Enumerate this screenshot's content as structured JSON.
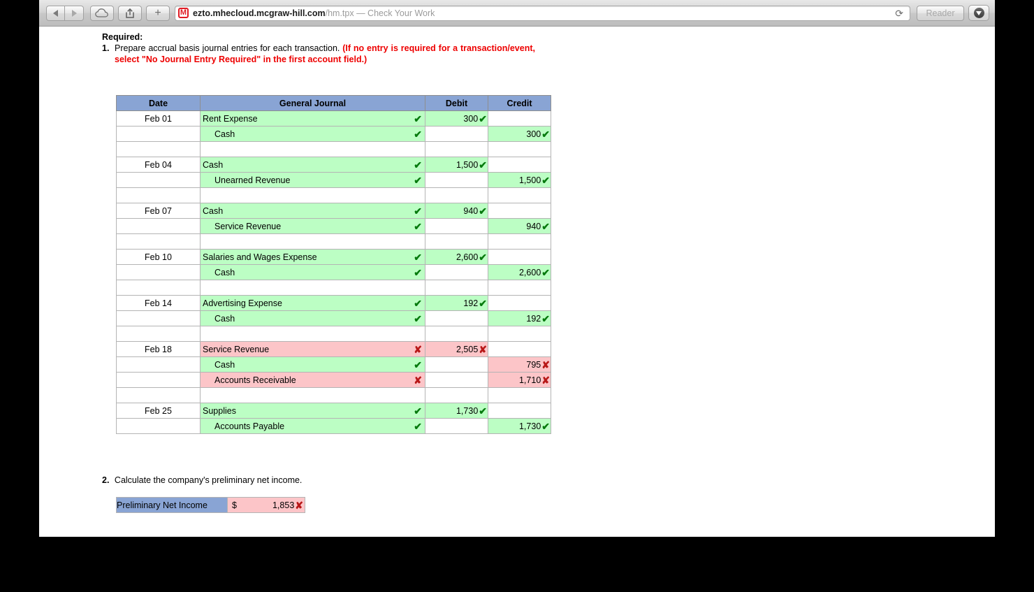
{
  "browser": {
    "back_icon": "triangle-left-icon",
    "forward_icon": "triangle-right-icon",
    "icloud_icon": "cloud-icon",
    "share_icon": "share-icon",
    "newtab_label": "+",
    "favicon_letter": "M",
    "url_host": "ezto.mhecloud.mcgraw-hill.com",
    "url_path": "/hm.tpx — Check Your Work",
    "reload_icon": "⟳",
    "reader_label": "Reader",
    "download_icon": "download-icon"
  },
  "page": {
    "required_label": "Required:",
    "instruction": {
      "number": "1.",
      "black_text": "Prepare accrual basis journal entries for each transaction.",
      "red_text": "(If no entry is required for a transaction/event, select \"No Journal Entry Required\" in the first account field.)"
    },
    "part2": {
      "number": "2.",
      "text": "Calculate the company's preliminary net income."
    },
    "net_income": {
      "label": "Preliminary Net Income",
      "currency": "$",
      "amount": "1,853",
      "mark": "✘",
      "mark_status": "incorrect"
    }
  },
  "journal": {
    "columns": [
      "Date",
      "General Journal",
      "Debit",
      "Credit"
    ],
    "marks": {
      "correct": "✔",
      "incorrect": "✘"
    },
    "colors": {
      "header_blue": "#89a4d4",
      "correct_green": "#bcfec4",
      "incorrect_pink": "#fcc5c8",
      "check_green": "#057a0d",
      "cross_red": "#b81818"
    },
    "rows": [
      {
        "type": "entry",
        "date": "Feb 01",
        "account": "Rent Expense",
        "indent": false,
        "acct_status": "correct",
        "debit": "300",
        "debit_status": "correct",
        "credit": "",
        "credit_status": ""
      },
      {
        "type": "entry",
        "date": "",
        "account": "Cash",
        "indent": true,
        "acct_status": "correct",
        "debit": "",
        "debit_status": "",
        "credit": "300",
        "credit_status": "correct"
      },
      {
        "type": "spacer"
      },
      {
        "type": "entry",
        "date": "Feb 04",
        "account": "Cash",
        "indent": false,
        "acct_status": "correct",
        "debit": "1,500",
        "debit_status": "correct",
        "credit": "",
        "credit_status": ""
      },
      {
        "type": "entry",
        "date": "",
        "account": "Unearned Revenue",
        "indent": true,
        "acct_status": "correct",
        "debit": "",
        "debit_status": "",
        "credit": "1,500",
        "credit_status": "correct"
      },
      {
        "type": "spacer"
      },
      {
        "type": "entry",
        "date": "Feb 07",
        "account": "Cash",
        "indent": false,
        "acct_status": "correct",
        "debit": "940",
        "debit_status": "correct",
        "credit": "",
        "credit_status": ""
      },
      {
        "type": "entry",
        "date": "",
        "account": "Service Revenue",
        "indent": true,
        "acct_status": "correct",
        "debit": "",
        "debit_status": "",
        "credit": "940",
        "credit_status": "correct"
      },
      {
        "type": "spacer"
      },
      {
        "type": "entry",
        "date": "Feb 10",
        "account": "Salaries and Wages Expense",
        "indent": false,
        "acct_status": "correct",
        "debit": "2,600",
        "debit_status": "correct",
        "credit": "",
        "credit_status": ""
      },
      {
        "type": "entry",
        "date": "",
        "account": "Cash",
        "indent": true,
        "acct_status": "correct",
        "debit": "",
        "debit_status": "",
        "credit": "2,600",
        "credit_status": "correct"
      },
      {
        "type": "spacer"
      },
      {
        "type": "entry",
        "date": "Feb 14",
        "account": "Advertising Expense",
        "indent": false,
        "acct_status": "correct",
        "debit": "192",
        "debit_status": "correct",
        "credit": "",
        "credit_status": ""
      },
      {
        "type": "entry",
        "date": "",
        "account": "Cash",
        "indent": true,
        "acct_status": "correct",
        "debit": "",
        "debit_status": "",
        "credit": "192",
        "credit_status": "correct"
      },
      {
        "type": "spacer"
      },
      {
        "type": "entry",
        "date": "Feb 18",
        "account": "Service Revenue",
        "indent": false,
        "acct_status": "incorrect",
        "debit": "2,505",
        "debit_status": "incorrect",
        "credit": "",
        "credit_status": ""
      },
      {
        "type": "entry",
        "date": "",
        "account": "Cash",
        "indent": true,
        "acct_status": "correct",
        "debit": "",
        "debit_status": "",
        "credit": "795",
        "credit_status": "incorrect"
      },
      {
        "type": "entry",
        "date": "",
        "account": "Accounts Receivable",
        "indent": true,
        "acct_status": "incorrect",
        "debit": "",
        "debit_status": "",
        "credit": "1,710",
        "credit_status": "incorrect"
      },
      {
        "type": "spacer"
      },
      {
        "type": "entry",
        "date": "Feb 25",
        "account": "Supplies",
        "indent": false,
        "acct_status": "correct",
        "debit": "1,730",
        "debit_status": "correct",
        "credit": "",
        "credit_status": ""
      },
      {
        "type": "entry",
        "date": "",
        "account": "Accounts Payable",
        "indent": true,
        "acct_status": "correct",
        "debit": "",
        "debit_status": "",
        "credit": "1,730",
        "credit_status": "correct"
      }
    ]
  }
}
